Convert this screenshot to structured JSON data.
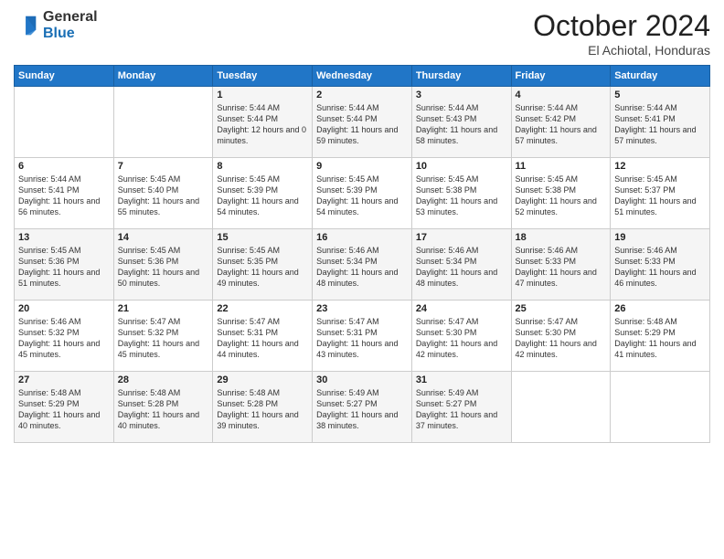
{
  "logo": {
    "general": "General",
    "blue": "Blue"
  },
  "header": {
    "month": "October 2024",
    "location": "El Achiotal, Honduras"
  },
  "days_of_week": [
    "Sunday",
    "Monday",
    "Tuesday",
    "Wednesday",
    "Thursday",
    "Friday",
    "Saturday"
  ],
  "weeks": [
    [
      null,
      null,
      {
        "day": 1,
        "sunrise": "5:44 AM",
        "sunset": "5:44 PM",
        "daylight": "12 hours and 0 minutes."
      },
      {
        "day": 2,
        "sunrise": "5:44 AM",
        "sunset": "5:44 PM",
        "daylight": "11 hours and 59 minutes."
      },
      {
        "day": 3,
        "sunrise": "5:44 AM",
        "sunset": "5:43 PM",
        "daylight": "11 hours and 58 minutes."
      },
      {
        "day": 4,
        "sunrise": "5:44 AM",
        "sunset": "5:42 PM",
        "daylight": "11 hours and 57 minutes."
      },
      {
        "day": 5,
        "sunrise": "5:44 AM",
        "sunset": "5:41 PM",
        "daylight": "11 hours and 57 minutes."
      }
    ],
    [
      {
        "day": 6,
        "sunrise": "5:44 AM",
        "sunset": "5:41 PM",
        "daylight": "11 hours and 56 minutes."
      },
      {
        "day": 7,
        "sunrise": "5:45 AM",
        "sunset": "5:40 PM",
        "daylight": "11 hours and 55 minutes."
      },
      {
        "day": 8,
        "sunrise": "5:45 AM",
        "sunset": "5:39 PM",
        "daylight": "11 hours and 54 minutes."
      },
      {
        "day": 9,
        "sunrise": "5:45 AM",
        "sunset": "5:39 PM",
        "daylight": "11 hours and 54 minutes."
      },
      {
        "day": 10,
        "sunrise": "5:45 AM",
        "sunset": "5:38 PM",
        "daylight": "11 hours and 53 minutes."
      },
      {
        "day": 11,
        "sunrise": "5:45 AM",
        "sunset": "5:38 PM",
        "daylight": "11 hours and 52 minutes."
      },
      {
        "day": 12,
        "sunrise": "5:45 AM",
        "sunset": "5:37 PM",
        "daylight": "11 hours and 51 minutes."
      }
    ],
    [
      {
        "day": 13,
        "sunrise": "5:45 AM",
        "sunset": "5:36 PM",
        "daylight": "11 hours and 51 minutes."
      },
      {
        "day": 14,
        "sunrise": "5:45 AM",
        "sunset": "5:36 PM",
        "daylight": "11 hours and 50 minutes."
      },
      {
        "day": 15,
        "sunrise": "5:45 AM",
        "sunset": "5:35 PM",
        "daylight": "11 hours and 49 minutes."
      },
      {
        "day": 16,
        "sunrise": "5:46 AM",
        "sunset": "5:34 PM",
        "daylight": "11 hours and 48 minutes."
      },
      {
        "day": 17,
        "sunrise": "5:46 AM",
        "sunset": "5:34 PM",
        "daylight": "11 hours and 48 minutes."
      },
      {
        "day": 18,
        "sunrise": "5:46 AM",
        "sunset": "5:33 PM",
        "daylight": "11 hours and 47 minutes."
      },
      {
        "day": 19,
        "sunrise": "5:46 AM",
        "sunset": "5:33 PM",
        "daylight": "11 hours and 46 minutes."
      }
    ],
    [
      {
        "day": 20,
        "sunrise": "5:46 AM",
        "sunset": "5:32 PM",
        "daylight": "11 hours and 45 minutes."
      },
      {
        "day": 21,
        "sunrise": "5:47 AM",
        "sunset": "5:32 PM",
        "daylight": "11 hours and 45 minutes."
      },
      {
        "day": 22,
        "sunrise": "5:47 AM",
        "sunset": "5:31 PM",
        "daylight": "11 hours and 44 minutes."
      },
      {
        "day": 23,
        "sunrise": "5:47 AM",
        "sunset": "5:31 PM",
        "daylight": "11 hours and 43 minutes."
      },
      {
        "day": 24,
        "sunrise": "5:47 AM",
        "sunset": "5:30 PM",
        "daylight": "11 hours and 42 minutes."
      },
      {
        "day": 25,
        "sunrise": "5:47 AM",
        "sunset": "5:30 PM",
        "daylight": "11 hours and 42 minutes."
      },
      {
        "day": 26,
        "sunrise": "5:48 AM",
        "sunset": "5:29 PM",
        "daylight": "11 hours and 41 minutes."
      }
    ],
    [
      {
        "day": 27,
        "sunrise": "5:48 AM",
        "sunset": "5:29 PM",
        "daylight": "11 hours and 40 minutes."
      },
      {
        "day": 28,
        "sunrise": "5:48 AM",
        "sunset": "5:28 PM",
        "daylight": "11 hours and 40 minutes."
      },
      {
        "day": 29,
        "sunrise": "5:48 AM",
        "sunset": "5:28 PM",
        "daylight": "11 hours and 39 minutes."
      },
      {
        "day": 30,
        "sunrise": "5:49 AM",
        "sunset": "5:27 PM",
        "daylight": "11 hours and 38 minutes."
      },
      {
        "day": 31,
        "sunrise": "5:49 AM",
        "sunset": "5:27 PM",
        "daylight": "11 hours and 37 minutes."
      },
      null,
      null
    ]
  ]
}
